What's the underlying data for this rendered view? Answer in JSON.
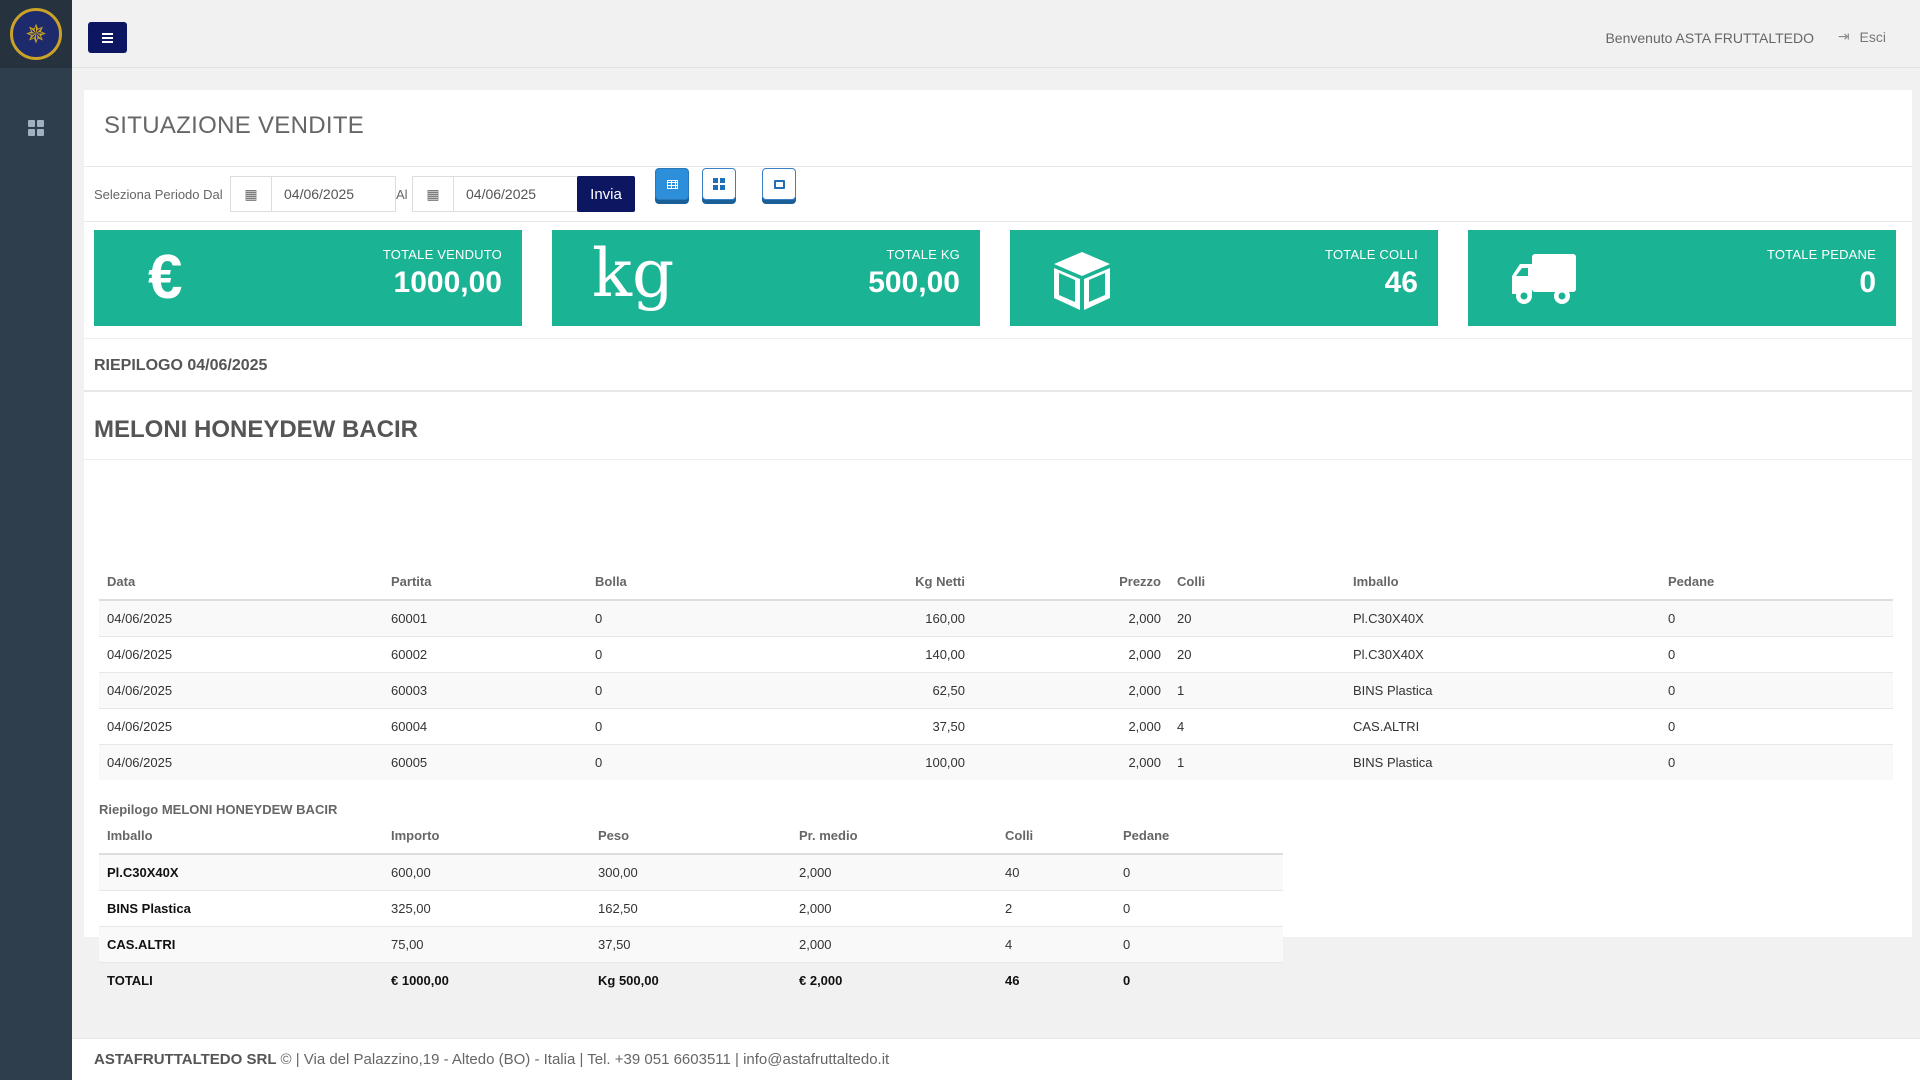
{
  "header": {
    "welcome": "Benvenuto ASTA FRUTTALTEDO",
    "logout_label": "Esci"
  },
  "page": {
    "title": "SITUAZIONE VENDITE"
  },
  "filter": {
    "from_label": "Seleziona Periodo Dal",
    "from_value": "04/06/2025",
    "to_label": "Al",
    "to_value": "04/06/2025",
    "submit_label": "Invia"
  },
  "stats": [
    {
      "label": "TOTALE VENDUTO",
      "value": "1000,00",
      "icon": "euro-icon",
      "glyph": "€"
    },
    {
      "label": "TOTALE KG",
      "value": "500,00",
      "icon": "kg-icon",
      "glyph": "kg"
    },
    {
      "label": "TOTALE COLLI",
      "value": "46",
      "icon": "cube-icon"
    },
    {
      "label": "TOTALE PEDANE",
      "value": "0",
      "icon": "truck-icon"
    }
  ],
  "recap": {
    "title": "RIEPILOGO 04/06/2025"
  },
  "product": {
    "name": "MELONI HONEYDEW BACIR",
    "columns": [
      "Data",
      "Partita",
      "Bolla",
      "Kg Netti",
      "Prezzo",
      "Colli",
      "Imballo",
      "Pedane"
    ],
    "rows": [
      {
        "data": "04/06/2025",
        "partita": "60001",
        "bolla": "0",
        "kg": "160,00",
        "prezzo": "2,000",
        "colli": "20",
        "imballo": "Pl.C30X40X",
        "pedane": "0"
      },
      {
        "data": "04/06/2025",
        "partita": "60002",
        "bolla": "0",
        "kg": "140,00",
        "prezzo": "2,000",
        "colli": "20",
        "imballo": "Pl.C30X40X",
        "pedane": "0"
      },
      {
        "data": "04/06/2025",
        "partita": "60003",
        "bolla": "0",
        "kg": "62,50",
        "prezzo": "2,000",
        "colli": "1",
        "imballo": "BINS Plastica",
        "pedane": "0"
      },
      {
        "data": "04/06/2025",
        "partita": "60004",
        "bolla": "0",
        "kg": "37,50",
        "prezzo": "2,000",
        "colli": "4",
        "imballo": "CAS.ALTRI",
        "pedane": "0"
      },
      {
        "data": "04/06/2025",
        "partita": "60005",
        "bolla": "0",
        "kg": "100,00",
        "prezzo": "2,000",
        "colli": "1",
        "imballo": "BINS Plastica",
        "pedane": "0"
      }
    ]
  },
  "summary": {
    "caption": "Riepilogo MELONI HONEYDEW BACIR",
    "columns": [
      "Imballo",
      "Importo",
      "Peso",
      "Pr. medio",
      "Colli",
      "Pedane"
    ],
    "rows": [
      {
        "imballo": "Pl.C30X40X",
        "importo": "600,00",
        "peso": "300,00",
        "prmedio": "2,000",
        "colli": "40",
        "pedane": "0"
      },
      {
        "imballo": "BINS Plastica",
        "importo": "325,00",
        "peso": "162,50",
        "prmedio": "2,000",
        "colli": "2",
        "pedane": "0"
      },
      {
        "imballo": "CAS.ALTRI",
        "importo": "75,00",
        "peso": "37,50",
        "prmedio": "2,000",
        "colli": "4",
        "pedane": "0"
      }
    ],
    "totals": {
      "label": "TOTALI",
      "importo": "€ 1000,00",
      "peso": "Kg 500,00",
      "prmedio": "€ 2,000",
      "colli": "46",
      "pedane": "0"
    }
  },
  "footer": {
    "company": "ASTAFRUTTALTEDO SRL",
    "details": "© | Via del Palazzino,19 - Altedo (BO) - Italia | Tel. +39 051 6603511 | info@astafruttaltedo.it"
  },
  "colors": {
    "accent": "#1ab394",
    "navy": "#0d1660",
    "sidebar": "#2f3e4c"
  }
}
